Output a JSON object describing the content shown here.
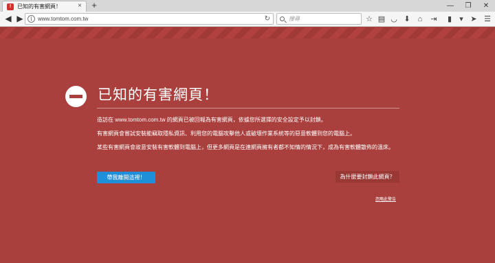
{
  "browser": {
    "tab": {
      "title": "已知的有害網頁！",
      "favicon_text": "!"
    },
    "url": "www.tomtom.com.tw",
    "search_placeholder": "搜尋"
  },
  "warning": {
    "title": "已知的有害網頁！",
    "paragraphs": [
      "造訪在 www.tomtom.com.tw 的網頁已被回報為有害網頁，依據您所選擇的安全設定予以封鎖。",
      "有害網頁會嘗試安裝能竊取隱私資訊、利用您的電腦攻擊他人或破壞作業系統等的惡意軟體到您的電腦上。",
      "某些有害網頁會故意安裝有害軟體到電腦上，但更多網頁是在連網頁擁有者都不知情的情況下，成為有害軟體散佈的溫床。"
    ],
    "leave_button": "帶我離開這裡！",
    "why_button": "為什麼要封鎖此網頁？",
    "ignore_link": "忽略此警告"
  },
  "colors": {
    "page_bg": "#a9403d",
    "primary_button": "#1f8fd9"
  }
}
